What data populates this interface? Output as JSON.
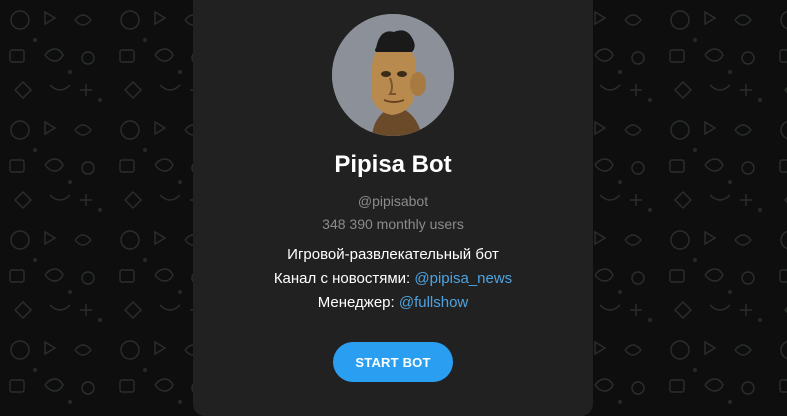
{
  "bot": {
    "name": "Pipisa Bot",
    "username": "@pipisabot",
    "monthly_users": "348 390 monthly users"
  },
  "description": {
    "line1": "Игровой-развлекательный бот",
    "channel_label": "Канал с новостями: ",
    "channel_link": "@pipisa_news",
    "manager_label": "Менеджер: ",
    "manager_link": "@fullshow"
  },
  "actions": {
    "start_label": "START BOT"
  },
  "colors": {
    "background": "#0e0e0e",
    "card": "#212121",
    "accent": "#2a9ef1",
    "link": "#4ea3e0",
    "muted_text": "#8b8b8b"
  },
  "icons": {
    "background": "doodle-pattern",
    "avatar": "bot-avatar"
  }
}
